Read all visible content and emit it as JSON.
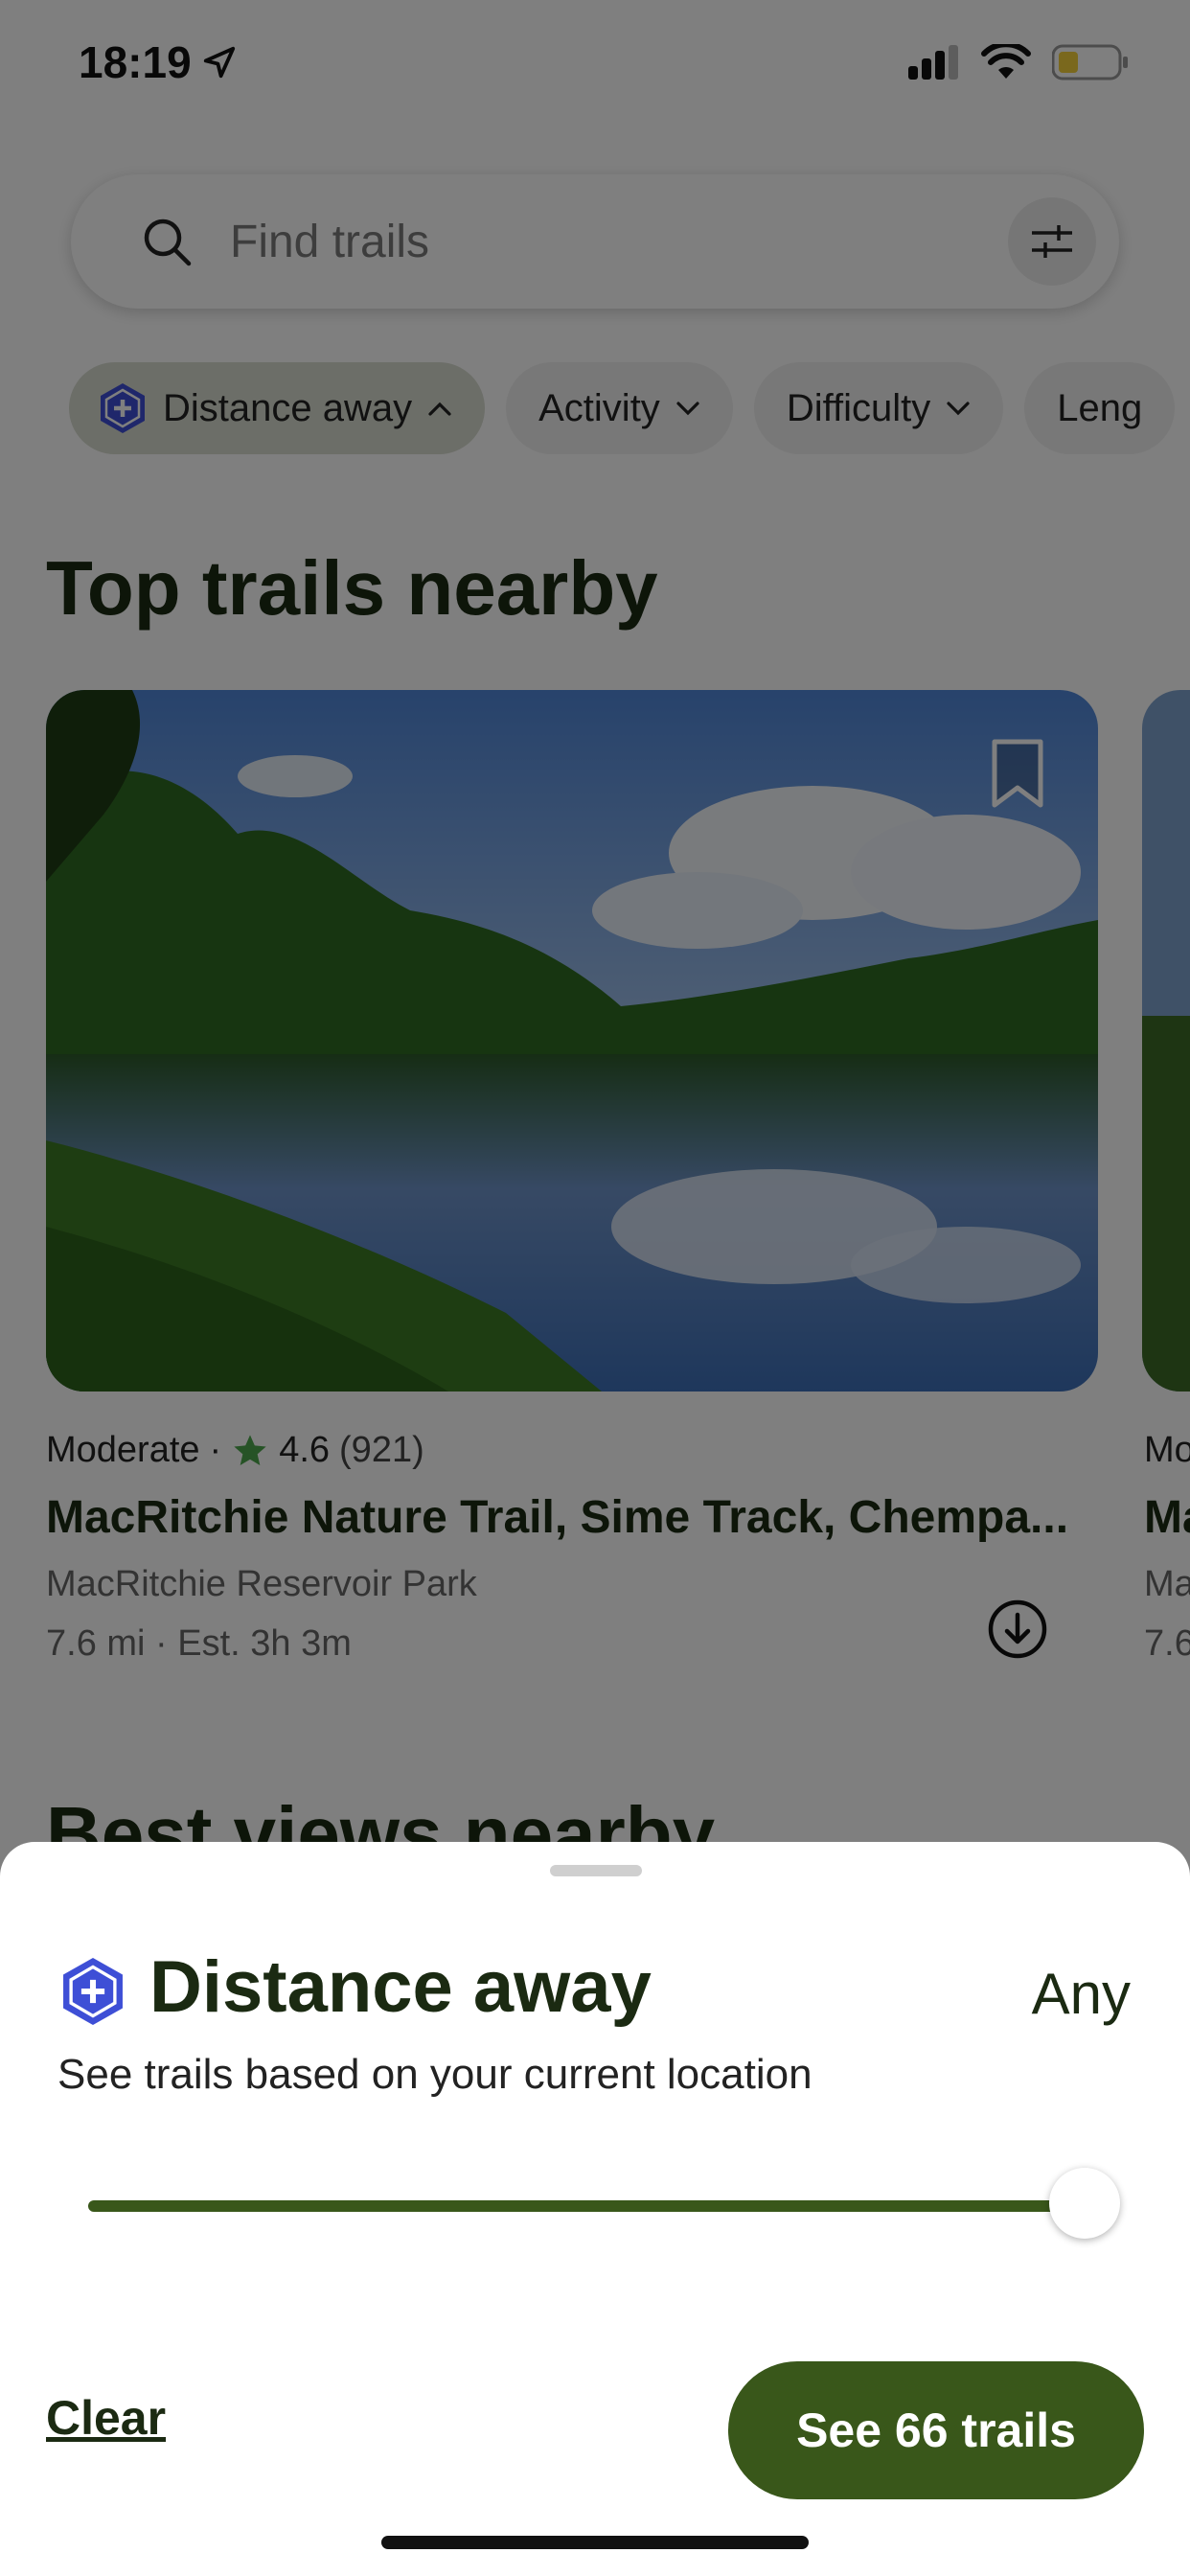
{
  "status_bar": {
    "time": "18:19"
  },
  "search": {
    "placeholder": "Find trails"
  },
  "filters": [
    {
      "label": "Distance away"
    },
    {
      "label": "Activity"
    },
    {
      "label": "Difficulty"
    },
    {
      "label": "Leng"
    }
  ],
  "section_top": {
    "title": "Top trails nearby"
  },
  "trail_card": {
    "difficulty": "Moderate",
    "rating": "4.6",
    "reviews": "(921)",
    "name": "MacRitchie Nature Trail, Sime Track, Chempa...",
    "park": "MacRitchie Reservoir Park",
    "distance": "7.6 mi",
    "time": "Est. 3h 3m"
  },
  "peek_card": {
    "difficulty": "Mo",
    "name": "Ma",
    "park": "Ma",
    "distance": "7.6"
  },
  "section_best": {
    "title": "Best views nearby"
  },
  "sheet": {
    "title": "Distance away",
    "value": "Any",
    "description": "See trails based on your current location",
    "slider_fraction": 1.0,
    "clear_label": "Clear",
    "see_label": "See 66 trails"
  },
  "colors": {
    "brand": "#39571a",
    "plus_badge": "#3e4fd6"
  }
}
